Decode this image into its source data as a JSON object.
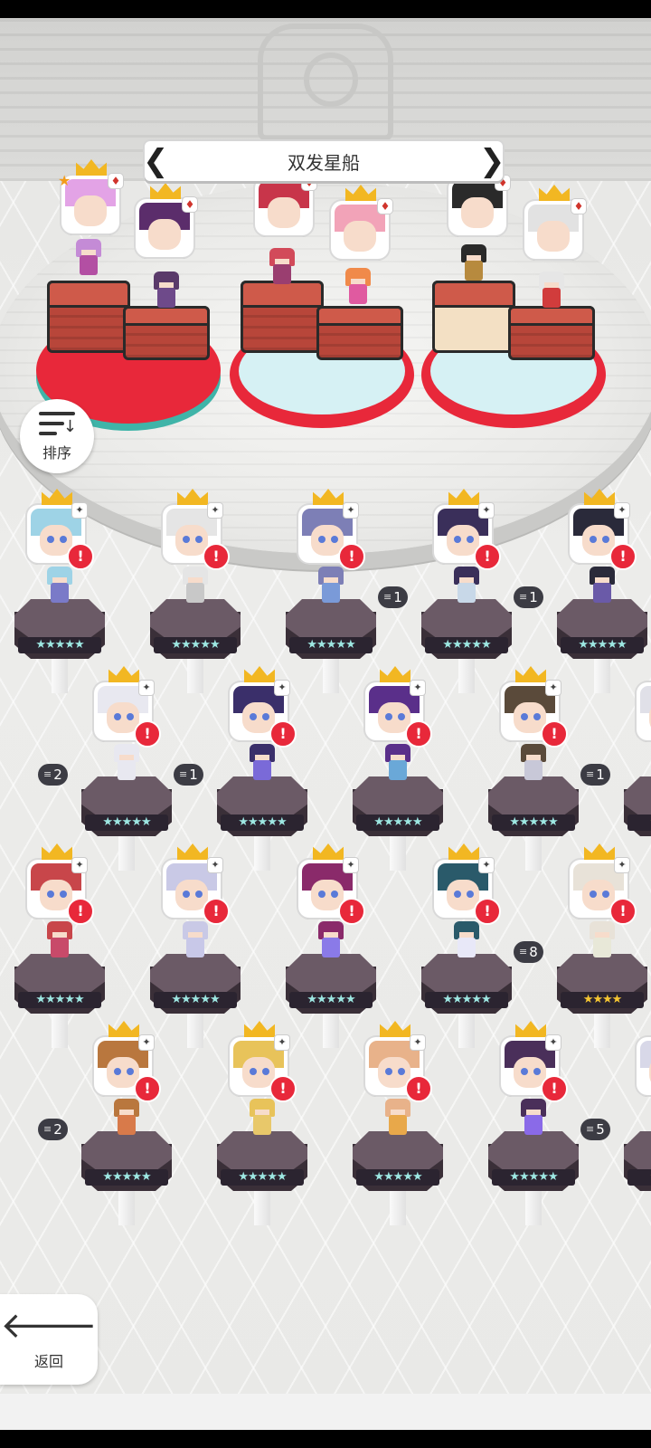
{
  "header": {
    "title": "双发星船",
    "prev_arrow": "❮",
    "next_arrow": "❯"
  },
  "buttons": {
    "sort_label": "排序",
    "back_label": "返回",
    "back_arrow": "🡐"
  },
  "featured": [
    {
      "crown": true,
      "suit": "♦",
      "star": "★"
    },
    {
      "crown": true,
      "suit": "♦"
    },
    {
      "crown": true,
      "suit": "♦"
    },
    {
      "crown": true,
      "suit": "♦"
    },
    {
      "crown": true,
      "suit": "♦"
    },
    {
      "crown": true,
      "suit": "♦"
    }
  ],
  "colors": {
    "crown": "#f2b722",
    "alert": "#e8283a",
    "pedestal_top": "#6b5a66",
    "red_platform": "#e8283a",
    "cyan_platform": "#d6f1f4"
  },
  "roster": {
    "alert_symbol": "!",
    "corner_mark": "✦",
    "rows": [
      [
        {
          "count": "",
          "stars": "★★★★★",
          "gold": false
        },
        {
          "count": "",
          "stars": "★★★★★",
          "gold": false
        },
        {
          "count": "",
          "stars": "★★★★★",
          "gold": false
        },
        {
          "count": "1",
          "stars": "★★★★★",
          "gold": false
        },
        {
          "count": "1",
          "stars": "★★★★★",
          "gold": false
        }
      ],
      [
        {
          "count": "2",
          "stars": "★★★★★",
          "gold": false
        },
        {
          "count": "1",
          "stars": "★★★★★",
          "gold": false
        },
        {
          "count": "",
          "stars": "★★★★★",
          "gold": false
        },
        {
          "count": "",
          "stars": "★★★★★",
          "gold": false
        },
        {
          "count": "1",
          "stars": "★★★★",
          "gold": true
        }
      ],
      [
        {
          "count": "",
          "stars": "★★★★★",
          "gold": false
        },
        {
          "count": "",
          "stars": "★★★★★",
          "gold": false
        },
        {
          "count": "",
          "stars": "★★★★★",
          "gold": false
        },
        {
          "count": "",
          "stars": "★★★★★",
          "gold": false
        },
        {
          "count": "8",
          "stars": "★★★★",
          "gold": true
        }
      ],
      [
        {
          "count": "2",
          "stars": "★★★★★",
          "gold": false
        },
        {
          "count": "",
          "stars": "★★★★★",
          "gold": false
        },
        {
          "count": "",
          "stars": "★★★★★",
          "gold": false
        },
        {
          "count": "",
          "stars": "★★★★★",
          "gold": false
        },
        {
          "count": "5",
          "stars": "★★★★",
          "gold": true
        }
      ]
    ]
  }
}
